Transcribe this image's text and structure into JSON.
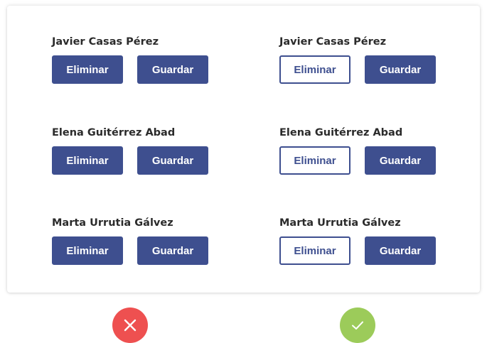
{
  "colors": {
    "primary": "#3e4f8f",
    "wrong": "#ee5050",
    "right": "#9ccb5a"
  },
  "wrong_example": {
    "rows": [
      {
        "name": "Javier Casas Pérez",
        "delete_label": "Eliminar",
        "save_label": "Guardar"
      },
      {
        "name": "Elena Guitérrez Abad",
        "delete_label": "Eliminar",
        "save_label": "Guardar"
      },
      {
        "name": "Marta Urrutia Gálvez",
        "delete_label": "Eliminar",
        "save_label": "Guardar"
      }
    ],
    "indicator_icon": "cross-icon"
  },
  "right_example": {
    "rows": [
      {
        "name": "Javier Casas Pérez",
        "delete_label": "Eliminar",
        "save_label": "Guardar"
      },
      {
        "name": "Elena Guitérrez Abad",
        "delete_label": "Eliminar",
        "save_label": "Guardar"
      },
      {
        "name": "Marta Urrutia Gálvez",
        "delete_label": "Eliminar",
        "save_label": "Guardar"
      }
    ],
    "indicator_icon": "check-icon"
  }
}
